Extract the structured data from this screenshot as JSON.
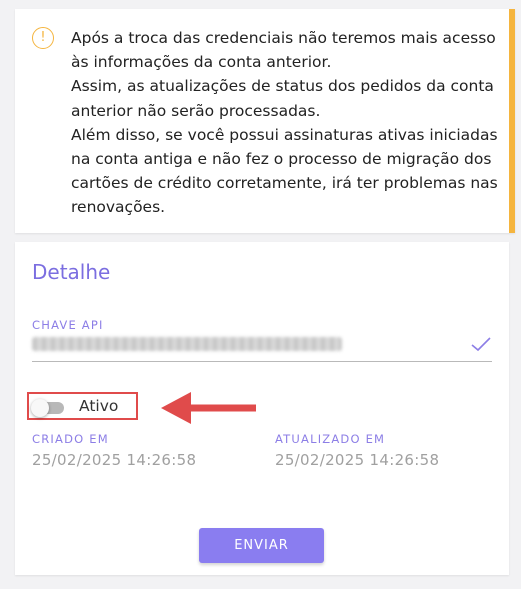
{
  "alert": {
    "icon": "exclamation-circle-icon",
    "icon_glyph": "!",
    "accent_color": "#f5b53f",
    "lines": [
      "Após a troca das credenciais não teremos mais acesso às informações da conta anterior.",
      "Assim, as atualizações de status dos pedidos da conta anterior não serão processadas.",
      "Além disso, se você possui assinaturas ativas iniciadas na conta antiga e não fez o processo de migração dos cartões de crédito corretamente, irá ter problemas nas renovações."
    ]
  },
  "detail": {
    "title": "Detalhe",
    "api_key": {
      "label": "CHAVE API",
      "value_blurred": true,
      "valid_icon": "checkmark-icon"
    },
    "active_toggle": {
      "label": "Ativo",
      "on": false
    },
    "created": {
      "label": "CRIADO EM",
      "value": "25/02/2025 14:26:58"
    },
    "updated": {
      "label": "ATUALIZADO EM",
      "value": "25/02/2025 14:26:58"
    },
    "submit_label": "ENVIAR",
    "accent_color": "#8a7df0"
  },
  "annotation": {
    "highlight_color": "#e04b4b",
    "arrow_icon": "left-arrow-icon"
  }
}
